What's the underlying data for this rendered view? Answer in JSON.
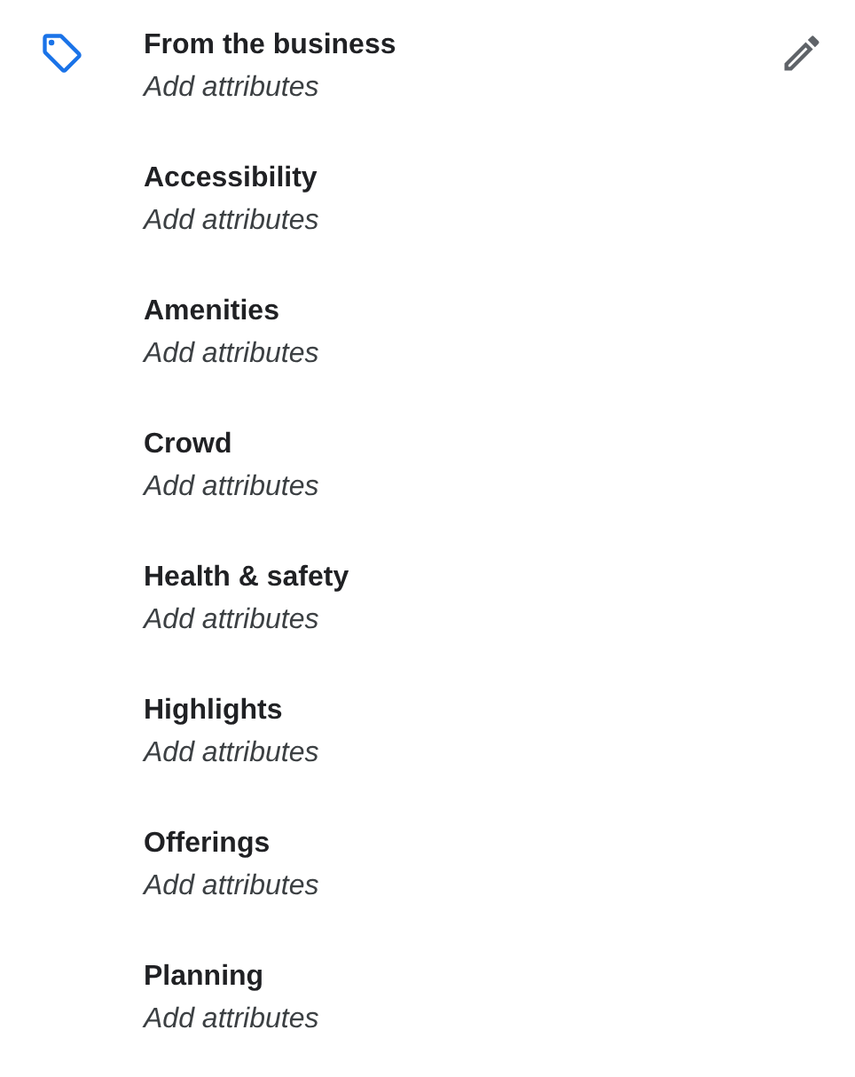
{
  "header": {
    "title": "From the business",
    "subtitle": "Add attributes"
  },
  "categories": [
    {
      "title": "Accessibility",
      "subtitle": "Add attributes"
    },
    {
      "title": "Amenities",
      "subtitle": "Add attributes"
    },
    {
      "title": "Crowd",
      "subtitle": "Add attributes"
    },
    {
      "title": "Health & safety",
      "subtitle": "Add attributes"
    },
    {
      "title": "Highlights",
      "subtitle": "Add attributes"
    },
    {
      "title": "Offerings",
      "subtitle": "Add attributes"
    },
    {
      "title": "Planning",
      "subtitle": "Add attributes"
    }
  ]
}
